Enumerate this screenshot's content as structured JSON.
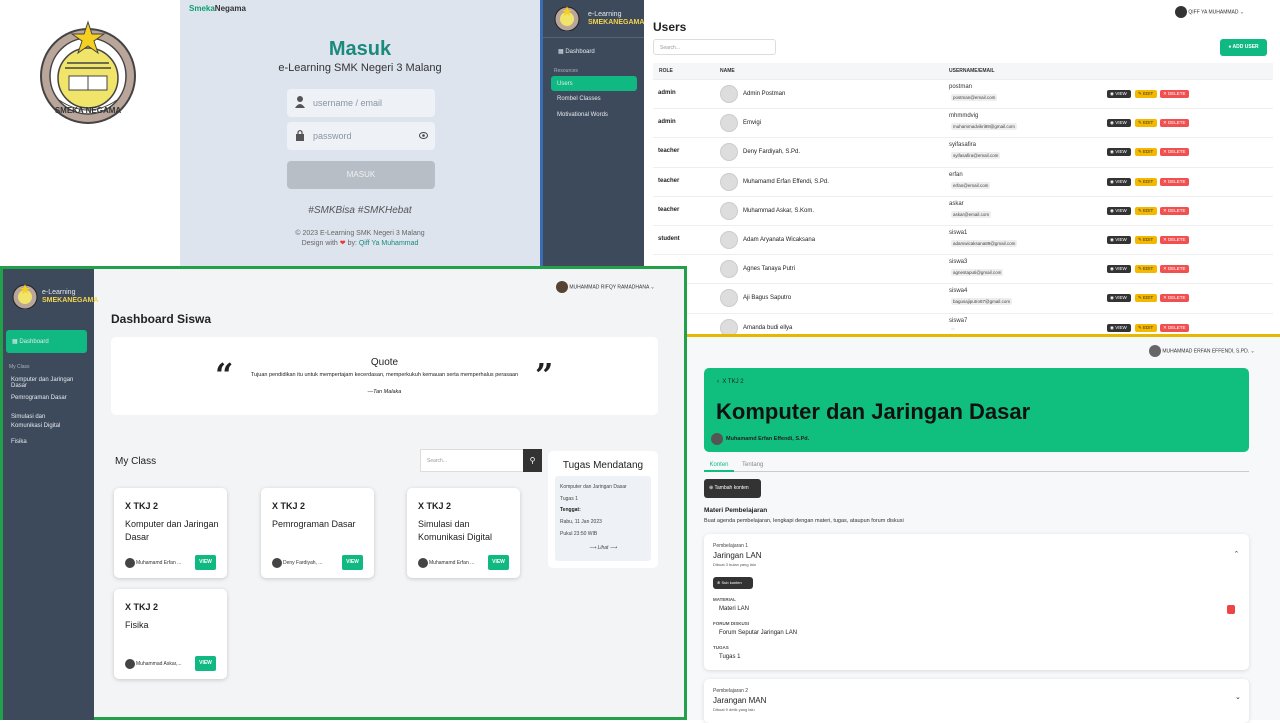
{
  "login": {
    "brand_a": "Smeka",
    "brand_b": "Negama",
    "title": "Masuk",
    "subtitle": "e-Learning SMK Negeri 3 Malang",
    "username_placeholder": "username / email",
    "password_placeholder": "password",
    "button": "MASUK",
    "tags": "#SMKBisa #SMKHebat",
    "footer1": "© 2023 E-Learning SMK Negeri 3 Malang",
    "footer2a": "Design with",
    "footer2b": "by",
    "footer2c": "Qiff Ya Muhammad",
    "logo_text": "SMEKA NEGAMA"
  },
  "admin": {
    "brand_top": "e-Learning",
    "brand_bottom": "SMEKANEGAMA",
    "user": "QIFF YA MUHAMMAD",
    "nav_dashboard": "Dashboard",
    "nav_section": "Resources",
    "nav_users": "Users",
    "nav_rombel": "Rombel Classes",
    "nav_motiv": "Motivational Words",
    "title": "Users",
    "search_placeholder": "Search...",
    "add_user": "ADD USER",
    "headers": [
      "ROLE",
      "NAME",
      "USERNAME/EMAIL"
    ],
    "btn_view": "VIEW",
    "btn_edit": "EDIT",
    "btn_delete": "DELETE",
    "rows": [
      {
        "role": "admin",
        "name": "Admin Postman",
        "username": "postman",
        "email": "postman@email.com"
      },
      {
        "role": "admin",
        "name": "Emvigi",
        "username": "mhmmdvig",
        "email": "muhammadvikri89@gmail.com"
      },
      {
        "role": "teacher",
        "name": "Deny Fardiyah, S.Pd.",
        "username": "syifasafira",
        "email": "syifasafira@email.com"
      },
      {
        "role": "teacher",
        "name": "Muhamamd Erfan Effendi, S.Pd.",
        "username": "erfan",
        "email": "erfan@email.com"
      },
      {
        "role": "teacher",
        "name": "Muhammad Askar, S.Kom.",
        "username": "askar",
        "email": "askar@email.com"
      },
      {
        "role": "student",
        "name": "Adam Aryanata Wicaksana",
        "username": "siswa1",
        "email": "adamwicaksana89@gmail.com"
      },
      {
        "role": "",
        "name": "Agnes Tanaya Putri",
        "username": "siswa3",
        "email": "agnestaputi@gmail.com"
      },
      {
        "role": "",
        "name": "Aji Bagus Saputro",
        "username": "siswa4",
        "email": "bagusajiputro87@gmail.com"
      },
      {
        "role": "",
        "name": "Amanda budi ellya",
        "username": "siswa7",
        "email": ""
      }
    ]
  },
  "student": {
    "brand_top": "e-Learning",
    "brand_bottom": "SMEKANEGAMA",
    "user": "MUHAMMAD RIFQY RAMADHANA",
    "nav_dashboard": "Dashboard",
    "nav_section": "My Class",
    "nav_items": [
      "Komputer dan Jaringan Dasar",
      "Pemrograman Dasar",
      "Simulasi dan Komunikasi Digital",
      "Fisika"
    ],
    "title": "Dashboard Siswa",
    "quote_title": "Quote",
    "quote_text": "Tujuan pendidikan itu untuk mempertajam kecerdasan, memperkukuh kemauan serta memperhalus perasaan",
    "quote_author": "—Tan Malaka",
    "myclass": "My Class",
    "search_placeholder": "Search...",
    "classes": [
      {
        "cls": "X TKJ 2",
        "subject": "Komputer dan Jaringan Dasar",
        "teacher": "Muhamamd Erfan ..."
      },
      {
        "cls": "X TKJ 2",
        "subject": "Pemrograman Dasar",
        "teacher": "Deny Fardiyah, ..."
      },
      {
        "cls": "X TKJ 2",
        "subject": "Simulasi dan Komunikasi Digital",
        "teacher": "Muhamamd Erfan ..."
      },
      {
        "cls": "X TKJ 2",
        "subject": "Fisika",
        "teacher": "Muhammad Askar,..."
      }
    ],
    "view": "VIEW",
    "tugas_title": "Tugas Mendatang",
    "tugas_course": "Komputer dan Jaringan Dasar",
    "tugas_name": "Tugas 1",
    "tenggat_label": "Tenggat:",
    "tenggat_date": "Rabu, 11 Jan 2023",
    "tenggat_time": "Pukul 23:50 WIB",
    "lihat": "Lihat"
  },
  "teacher": {
    "user": "MUHAMMAD ERFAN EFFENDI, S.PD.",
    "breadcrumb": "X TKJ 2",
    "title": "Komputer dan Jaringan Dasar",
    "teacher_name": "Muhamamd Erfan Effendi, S.Pd.",
    "tab_konten": "Konten",
    "tab_tentang": "Tentang",
    "tambah": "Tambah konten",
    "materi_title": "Materi Pembelajaran",
    "materi_desc": "Buat agenda pembelajaran, lengkapi dengan materi, tugas, ataupun forum diskusi",
    "p1_label": "Pembelajaran 1",
    "p1_title": "Jaringan LAN",
    "p1_time": "Dibuat 3 bulan yang lalu",
    "sub_konten": "Sub konten",
    "material_label": "MATERIAL",
    "material_item": "Materi LAN",
    "forum_label": "FORUM DISKUSI",
    "forum_item": "Forum Seputar Jaringan LAN",
    "tugas_label": "TUGAS",
    "tugas_item": "Tugas 1",
    "p2_label": "Pembelajaran 2",
    "p2_title": "Jarangan MAN",
    "p2_time": "Dibuat 9 detik yang lalu"
  },
  "colors": {
    "accent": "#0fb981",
    "sidebar": "#3d4a5b",
    "login_title": "#1b8a7d"
  }
}
